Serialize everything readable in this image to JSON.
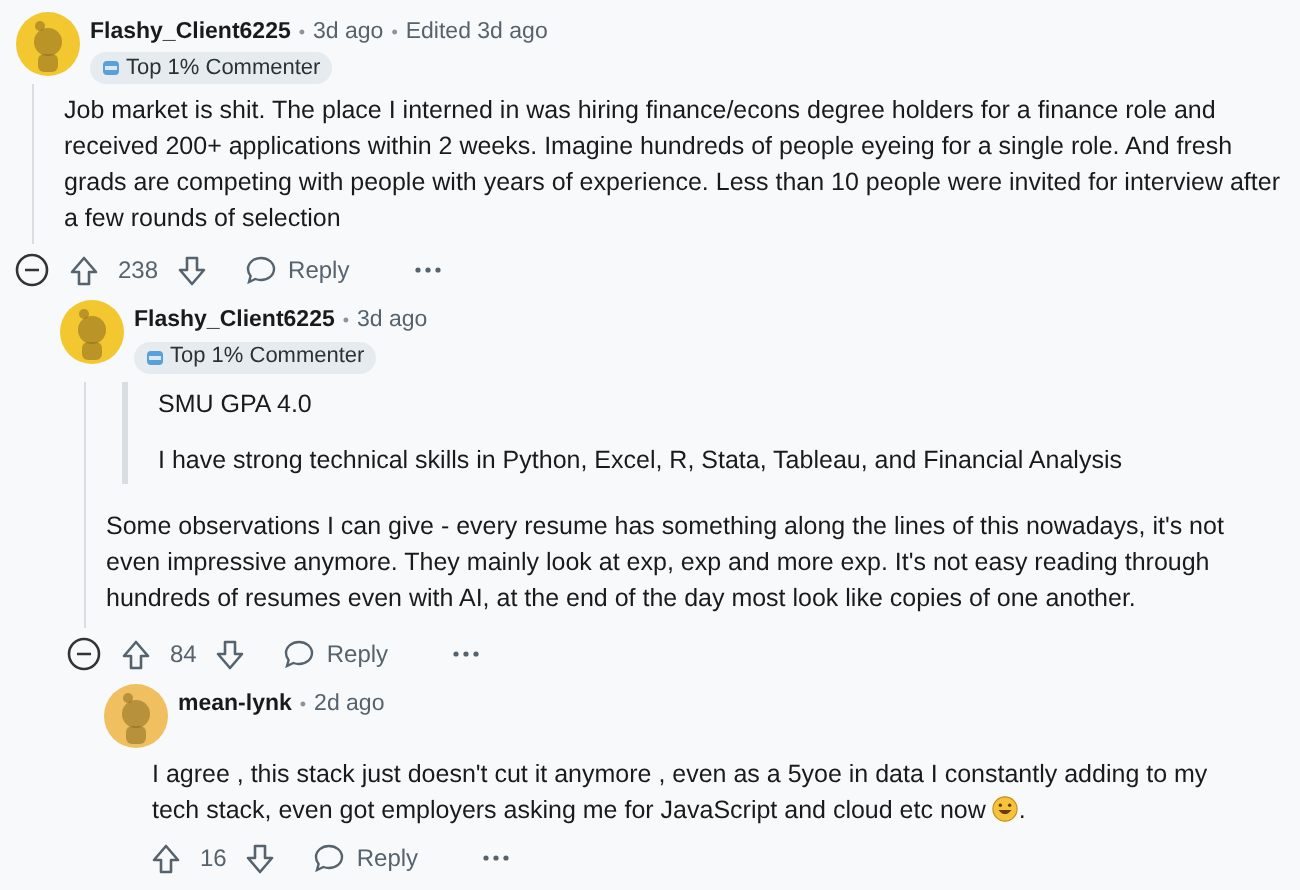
{
  "comments": [
    {
      "author": "Flashy_Client6225",
      "separator": "•",
      "meta": [
        "3d ago",
        "Edited 3d ago"
      ],
      "flair": "Top 1% Commenter",
      "body": "Job market is shit. The place I interned in was hiring finance/econs degree holders for a finance role and received 200+ applications within 2 weeks. Imagine hundreds of people eyeing for a single role. And fresh grads are competing with people with years of experience. Less than 10 people were invited for interview after a few rounds of selection",
      "score": "238",
      "reply": "Reply",
      "collapsible": true
    },
    {
      "author": "Flashy_Client6225",
      "separator": "•",
      "meta": [
        "3d ago"
      ],
      "flair": "Top 1% Commenter",
      "quote": [
        "SMU GPA 4.0",
        "I have strong technical skills in Python, Excel, R, Stata, Tableau, and Financial Analysis"
      ],
      "body": "Some observations I can give - every resume has something along the lines of this nowadays, it's not even impressive anymore. They mainly look at exp, exp and more exp. It's not easy reading through hundreds of resumes even with AI, at the end of the day most look like copies of one another.",
      "score": "84",
      "reply": "Reply",
      "collapsible": true
    },
    {
      "author": "mean-lynk",
      "separator": "•",
      "meta": [
        "2d ago"
      ],
      "body": "I agree , this stack just doesn't cut it anymore , even as a 5yoe in data I constantly adding to my tech stack, even got employers asking me for JavaScript and cloud etc now",
      "body_end": ".",
      "score": "16",
      "reply": "Reply",
      "collapsible": false
    }
  ]
}
